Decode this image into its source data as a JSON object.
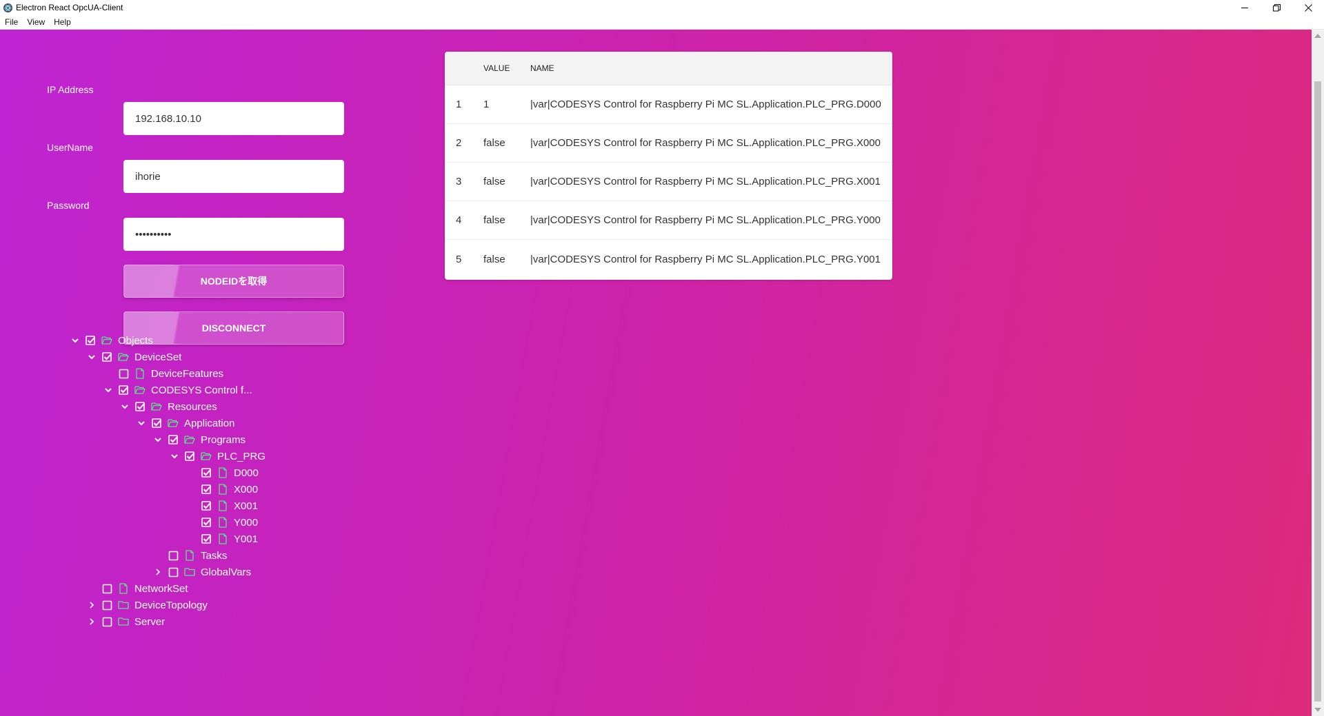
{
  "window": {
    "title": "Electron React OpcUA-Client",
    "menu": [
      "File",
      "View",
      "Help"
    ]
  },
  "form": {
    "ip_label": "IP Address",
    "ip_value": "192.168.10.10",
    "username_label": "UserName",
    "username_value": "ihorie",
    "password_label": "Password",
    "password_value": "••••••••••",
    "get_nodeid_button": "NODEIDを取得",
    "disconnect_button": "DISCONNECT"
  },
  "table": {
    "headers": [
      "",
      "VALUE",
      "NAME"
    ],
    "rows": [
      {
        "index": "1",
        "value": "1",
        "name": "|var|CODESYS Control for Raspberry Pi MC SL.Application.PLC_PRG.D000"
      },
      {
        "index": "2",
        "value": "false",
        "name": "|var|CODESYS Control for Raspberry Pi MC SL.Application.PLC_PRG.X000"
      },
      {
        "index": "3",
        "value": "false",
        "name": "|var|CODESYS Control for Raspberry Pi MC SL.Application.PLC_PRG.X001"
      },
      {
        "index": "4",
        "value": "false",
        "name": "|var|CODESYS Control for Raspberry Pi MC SL.Application.PLC_PRG.Y000"
      },
      {
        "index": "5",
        "value": "false",
        "name": "|var|CODESYS Control for Raspberry Pi MC SL.Application.PLC_PRG.Y001"
      }
    ]
  },
  "tree": [
    {
      "label": "Objects",
      "level": 0,
      "toggle": "expanded",
      "checked": true,
      "icon": "folder-open-icon"
    },
    {
      "label": "DeviceSet",
      "level": 1,
      "toggle": "expanded",
      "checked": true,
      "icon": "folder-open-icon"
    },
    {
      "label": "DeviceFeatures",
      "level": 2,
      "toggle": "none",
      "checked": false,
      "icon": "file-icon"
    },
    {
      "label": "CODESYS Control f...",
      "level": 2,
      "toggle": "expanded",
      "checked": true,
      "icon": "folder-open-icon"
    },
    {
      "label": "Resources",
      "level": 3,
      "toggle": "expanded",
      "checked": true,
      "icon": "folder-open-icon"
    },
    {
      "label": "Application",
      "level": 4,
      "toggle": "expanded",
      "checked": true,
      "icon": "folder-open-icon"
    },
    {
      "label": "Programs",
      "level": 5,
      "toggle": "expanded",
      "checked": true,
      "icon": "folder-open-icon"
    },
    {
      "label": "PLC_PRG",
      "level": 6,
      "toggle": "expanded",
      "checked": true,
      "icon": "folder-open-icon"
    },
    {
      "label": "D000",
      "level": 7,
      "toggle": "none",
      "checked": true,
      "icon": "file-icon"
    },
    {
      "label": "X000",
      "level": 7,
      "toggle": "none",
      "checked": true,
      "icon": "file-icon"
    },
    {
      "label": "X001",
      "level": 7,
      "toggle": "none",
      "checked": true,
      "icon": "file-icon"
    },
    {
      "label": "Y000",
      "level": 7,
      "toggle": "none",
      "checked": true,
      "icon": "file-icon"
    },
    {
      "label": "Y001",
      "level": 7,
      "toggle": "none",
      "checked": true,
      "icon": "file-icon"
    },
    {
      "label": "Tasks",
      "level": 5,
      "toggle": "none",
      "checked": false,
      "icon": "file-icon"
    },
    {
      "label": "GlobalVars",
      "level": 5,
      "toggle": "collapsed",
      "checked": false,
      "icon": "folder-icon"
    },
    {
      "label": "NetworkSet",
      "level": 1,
      "toggle": "none",
      "checked": false,
      "icon": "file-icon"
    },
    {
      "label": "DeviceTopology",
      "level": 1,
      "toggle": "collapsed",
      "checked": false,
      "icon": "folder-icon"
    },
    {
      "label": "Server",
      "level": 1,
      "toggle": "collapsed",
      "checked": false,
      "icon": "folder-icon"
    }
  ],
  "colors": {
    "gradient_start": "#be24d2",
    "gradient_end": "#dc2a7c",
    "tree_icon": "#5fe08a",
    "text_light": "#ffffff"
  }
}
